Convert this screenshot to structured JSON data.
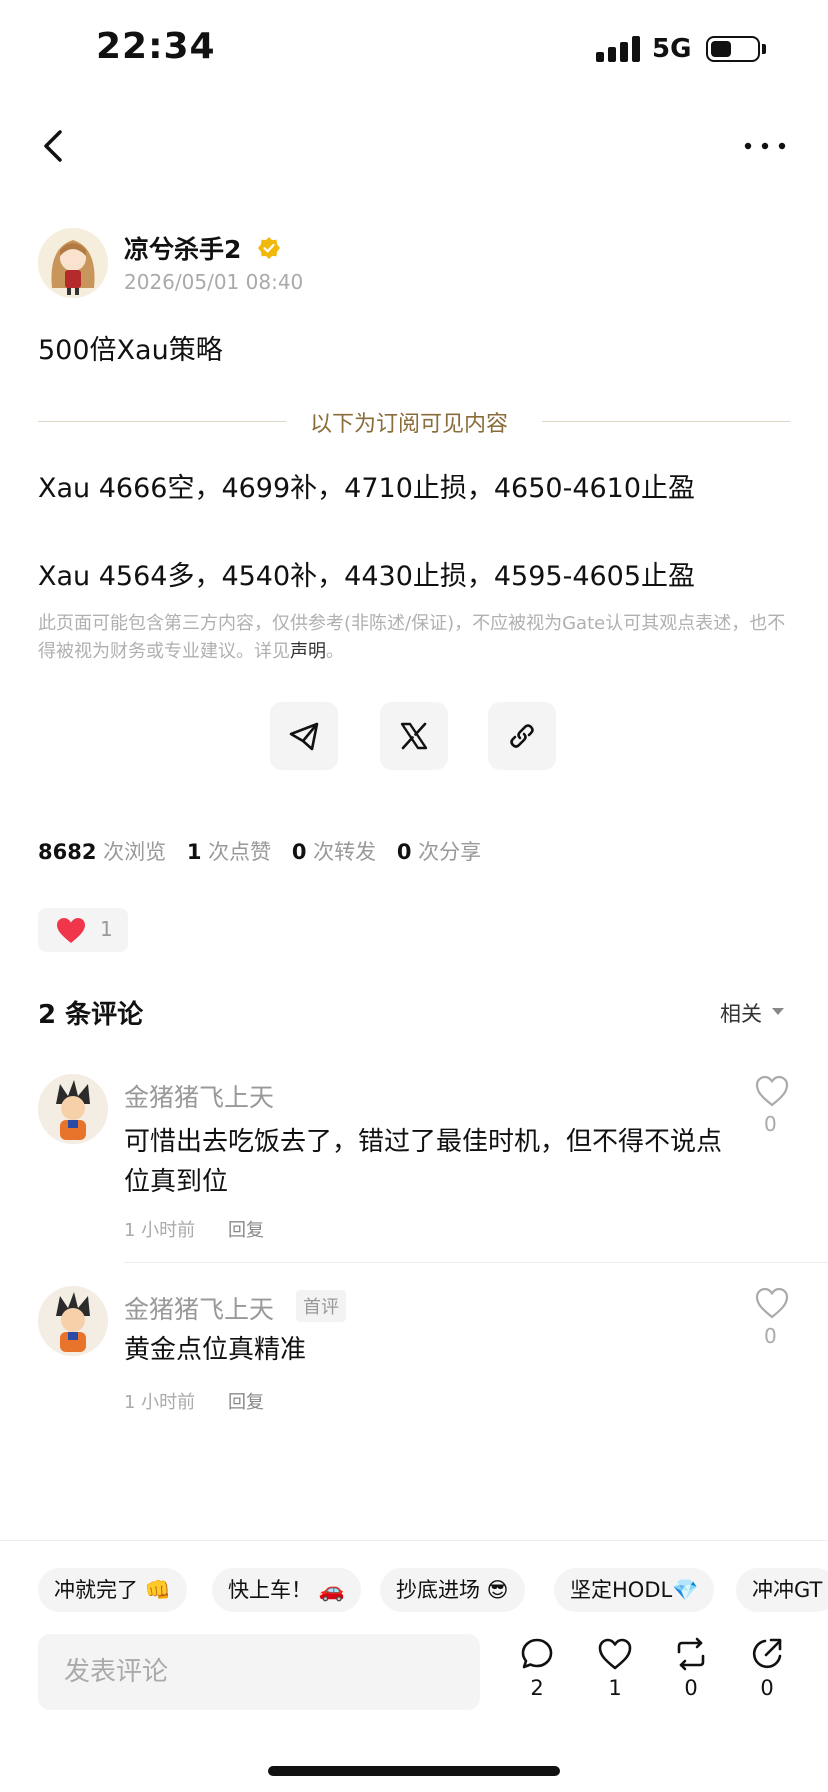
{
  "status_bar": {
    "time": "22:34",
    "network": "5G"
  },
  "author": {
    "name": "凉兮杀手2",
    "time": "2026/05/01 08:40"
  },
  "post": {
    "title": "500倍Xau策略",
    "subscriber_divider": "以下为订阅可见内容",
    "lines": [
      "Xau 4666空，4699补，4710止损，4650-4610止盈",
      "Xau 4564多，4540补，4430止损，4595-4605止盈"
    ],
    "disclaimer_text": "此页面可能包含第三方内容，仅供参考(非陈述/保证)，不应被视为Gate认可其观点表述，也不得被视为财务或专业建议。详见",
    "disclaimer_link": "声明",
    "disclaimer_end": "。"
  },
  "share": {
    "icons": [
      "telegram-icon",
      "x-icon",
      "link-icon"
    ]
  },
  "stats": {
    "views": "8682",
    "views_label": "次浏览",
    "likes": "1",
    "likes_label": "次点赞",
    "reposts": "0",
    "reposts_label": "次转发",
    "shares": "0",
    "shares_label": "次分享"
  },
  "reaction": {
    "emoji": "heart",
    "count": "1"
  },
  "comments": {
    "title": "2 条评论",
    "sort_label": "相关",
    "items": [
      {
        "name": "金猪猪飞上天",
        "badge": "",
        "text": "可惜出去吃饭去了，错过了最佳时机，但不得不说点位真到位",
        "time": "1 小时前",
        "reply": "回复",
        "likes": "0"
      },
      {
        "name": "金猪猪飞上天",
        "badge": "首评",
        "text": "黄金点位真精准",
        "time": "1 小时前",
        "reply": "回复",
        "likes": "0"
      }
    ]
  },
  "quick_replies": [
    "冲就完了 👊",
    "快上车！ 🚗",
    "抄底进场 😎",
    "坚定HODL💎",
    "冲冲GT"
  ],
  "composer": {
    "placeholder": "发表评论"
  },
  "actions": {
    "comments": "2",
    "likes": "1",
    "reposts": "0",
    "shares": "0"
  },
  "colors": {
    "accent_gold": "#8a6d3b",
    "verified": "#f0b90b",
    "heart": "#f0364b"
  }
}
